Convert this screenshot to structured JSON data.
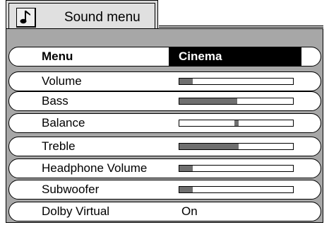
{
  "header": {
    "title": "Sound menu",
    "icon": "music-note-icon"
  },
  "menu_row": {
    "label": "Menu",
    "value": "Cinema"
  },
  "settings": [
    {
      "label": "Volume",
      "type": "bar",
      "level": 0.12
    },
    {
      "label": "Bass",
      "type": "bar",
      "level": 0.51
    },
    {
      "label": "Balance",
      "type": "balance",
      "level": 0.5
    },
    {
      "label": "Treble",
      "type": "bar",
      "level": 0.52
    },
    {
      "label": "Headphone Volume",
      "type": "bar",
      "level": 0.12
    },
    {
      "label": "Subwoofer",
      "type": "bar",
      "level": 0.12
    },
    {
      "label": "Dolby Virtual",
      "type": "text",
      "value": "On"
    }
  ],
  "colors": {
    "frame": "#a7a7a7",
    "bar_fill": "#6f6f6f",
    "selected_bg": "#000000",
    "selected_text": "#ffffff"
  }
}
